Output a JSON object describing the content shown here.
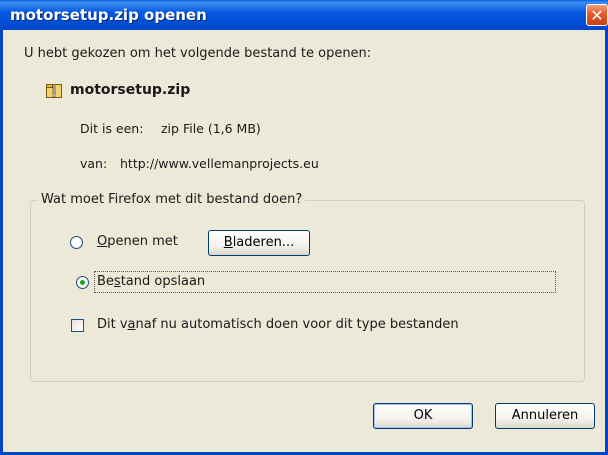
{
  "window": {
    "title": "motorsetup.zip openen",
    "close_glyph": "✕"
  },
  "intro_text": "U hebt gekozen om het volgende bestand te openen:",
  "file": {
    "icon": "zip-folder-icon",
    "name": "motorsetup.zip",
    "type_label": "Dit is een:",
    "type_value": "zip File (1,6 MB)",
    "from_label": "van:",
    "from_value": "http://www.vellemanprojects.eu"
  },
  "action_group": {
    "legend": "Wat moet Firefox met dit bestand doen?",
    "open_with": {
      "accel": "O",
      "rest": "penen met",
      "selected": false
    },
    "browse_button": {
      "accel": "B",
      "rest": "laderen..."
    },
    "save_file": {
      "pre": "Be",
      "accel": "s",
      "rest": "tand opslaan",
      "selected": true
    },
    "auto_checkbox": {
      "pre": "Dit v",
      "accel": "a",
      "rest": "naf nu automatisch doen voor dit type bestanden",
      "checked": false
    }
  },
  "buttons": {
    "ok": "OK",
    "cancel": "Annuleren"
  }
}
